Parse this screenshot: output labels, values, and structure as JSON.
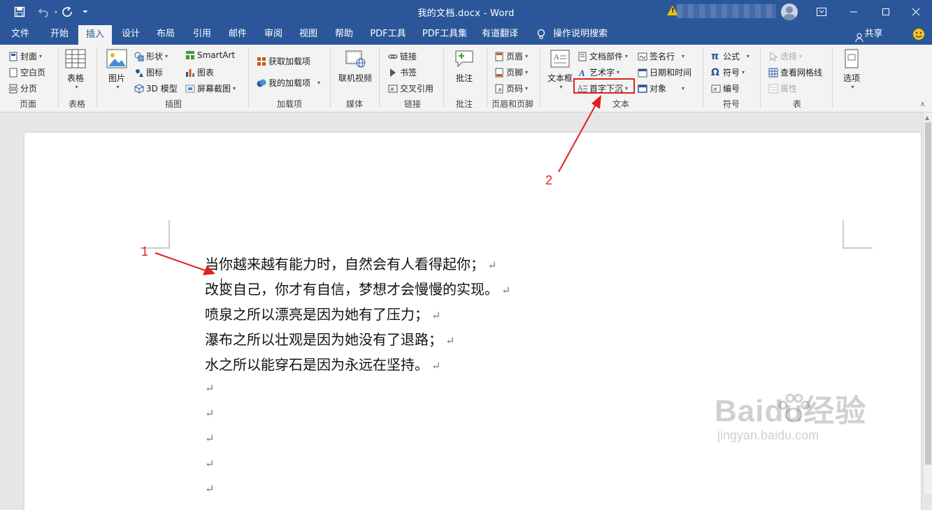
{
  "window": {
    "title": "我的文档.docx  -  Word",
    "account_name_blurred": true
  },
  "quick_access": [
    "save-icon",
    "undo-icon",
    "redo-icon",
    "customize-icon"
  ],
  "tabs": [
    {
      "label": "文件"
    },
    {
      "label": "开始"
    },
    {
      "label": "插入",
      "active": true
    },
    {
      "label": "设计"
    },
    {
      "label": "布局"
    },
    {
      "label": "引用"
    },
    {
      "label": "邮件"
    },
    {
      "label": "审阅"
    },
    {
      "label": "视图"
    },
    {
      "label": "帮助"
    },
    {
      "label": "PDF工具"
    },
    {
      "label": "PDF工具集"
    },
    {
      "label": "有道翻译"
    },
    {
      "label": "操作说明搜索"
    }
  ],
  "share_label": "共享",
  "ribbon": {
    "pages": {
      "label": "页面",
      "cover": "封面",
      "blank": "空白页",
      "break": "分页"
    },
    "tables": {
      "label": "表格",
      "table": "表格"
    },
    "illustrations": {
      "label": "插图",
      "pictures": "图片",
      "shapes": "形状",
      "icons": "图标",
      "model3d": "3D 模型",
      "smartart": "SmartArt",
      "chart": "图表",
      "screenshot": "屏幕截图"
    },
    "addins": {
      "label": "加载项",
      "get": "获取加载项",
      "my": "我的加载项"
    },
    "media": {
      "label": "媒体",
      "online_video": "联机视频"
    },
    "links": {
      "label": "链接",
      "link": "链接",
      "bookmark": "书签",
      "cross_ref": "交叉引用"
    },
    "comments": {
      "label": "批注",
      "comment": "批注"
    },
    "header_footer": {
      "label": "页眉和页脚",
      "header": "页眉",
      "footer": "页脚",
      "page_number": "页码"
    },
    "text": {
      "label": "文本",
      "text_box": "文本框",
      "quick_parts": "文档部件",
      "wordart": "艺术字",
      "drop_cap": "首字下沉",
      "signature_line": "签名行",
      "date_time": "日期和时间",
      "object": "对象"
    },
    "symbols": {
      "label": "符号",
      "equation": "公式",
      "symbol": "符号",
      "numbering": "编号"
    },
    "table_tools": {
      "label": "表",
      "select": "选择",
      "gridlines": "查看网格线",
      "properties": "属性"
    },
    "options": {
      "label": "选项"
    }
  },
  "document": {
    "paragraphs": [
      "当你越来越有能力时，自然会有人看得起你；",
      "改变自己，你才有自信，梦想才会慢慢的实现。",
      "喷泉之所以漂亮是因为她有了压力；",
      "瀑布之所以壮观是因为她没有了退路；",
      "水之所以能穿石是因为永远在坚持。",
      "",
      "",
      "",
      "",
      ""
    ],
    "paragraph_mark": "↵"
  },
  "annotations": {
    "label1": "1",
    "label2": "2",
    "color": "#e02020"
  },
  "watermark": {
    "brand": "Baidu经验",
    "url": "jingyan.baidu.com"
  },
  "colors": {
    "accent": "#2b579a",
    "annotation": "#e02020"
  }
}
